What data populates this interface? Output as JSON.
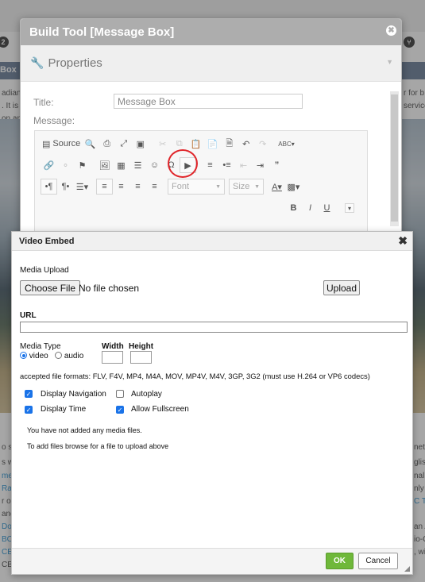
{
  "background": {
    "badge_left": "2",
    "badge_right": "⑂",
    "label_box": "Box",
    "left_fragments": [
      "adian",
      ". It is",
      "on an"
    ],
    "right_fragments": [
      "r for b",
      "service"
    ],
    "bottom_left": [
      "o so",
      "s wa",
      "me a",
      "Rad",
      "r or",
      "ang",
      "Do",
      "BC",
      "CE",
      "CBC"
    ],
    "bottom_right": [
      "net",
      "glis",
      "nal",
      "nly",
      "C T",
      "an A",
      "io-C",
      ", wi"
    ]
  },
  "build_tool": {
    "title": "Build Tool [Message Box]",
    "close_icon": "✖",
    "properties_label": "Properties",
    "title_field_label": "Title:",
    "title_value": "Message Box",
    "message_label": "Message:",
    "toolbar": {
      "source_label": "Source",
      "font_placeholder": "Font",
      "size_placeholder": "Size",
      "bold": "B",
      "italic": "I",
      "underline": "U"
    }
  },
  "video_embed": {
    "title": "Video Embed",
    "close_icon": "✖",
    "media_upload_label": "Media Upload",
    "choose_file_label": "Choose File",
    "no_file_text": "No file chosen",
    "upload_label": "Upload",
    "url_label": "URL",
    "url_value": "",
    "media_type_label": "Media Type",
    "radio_video": "video",
    "radio_audio": "audio",
    "media_type_selected": "video",
    "width_label": "Width",
    "height_label": "Height",
    "width_value": "",
    "height_value": "",
    "formats_text": "accepted file formats: FLV, F4V, MP4, M4A, MOV, MP4V, M4V, 3GP, 3G2 (must use H.264 or VP6 codecs)",
    "options": [
      {
        "label": "Display Navigation",
        "checked": true
      },
      {
        "label": "Autoplay",
        "checked": false
      },
      {
        "label": "Display Time",
        "checked": true
      },
      {
        "label": "Allow Fullscreen",
        "checked": true
      }
    ],
    "no_media_text": "You have not added any media files.",
    "add_files_text": "To add files browse for a file to upload above",
    "ok_label": "OK",
    "cancel_label": "Cancel"
  },
  "colors": {
    "ok_green": "#6fb83a",
    "highlight_red": "#e0252a",
    "checkbox_blue": "#1a73e8",
    "titlebar_gray": "#adadad"
  }
}
